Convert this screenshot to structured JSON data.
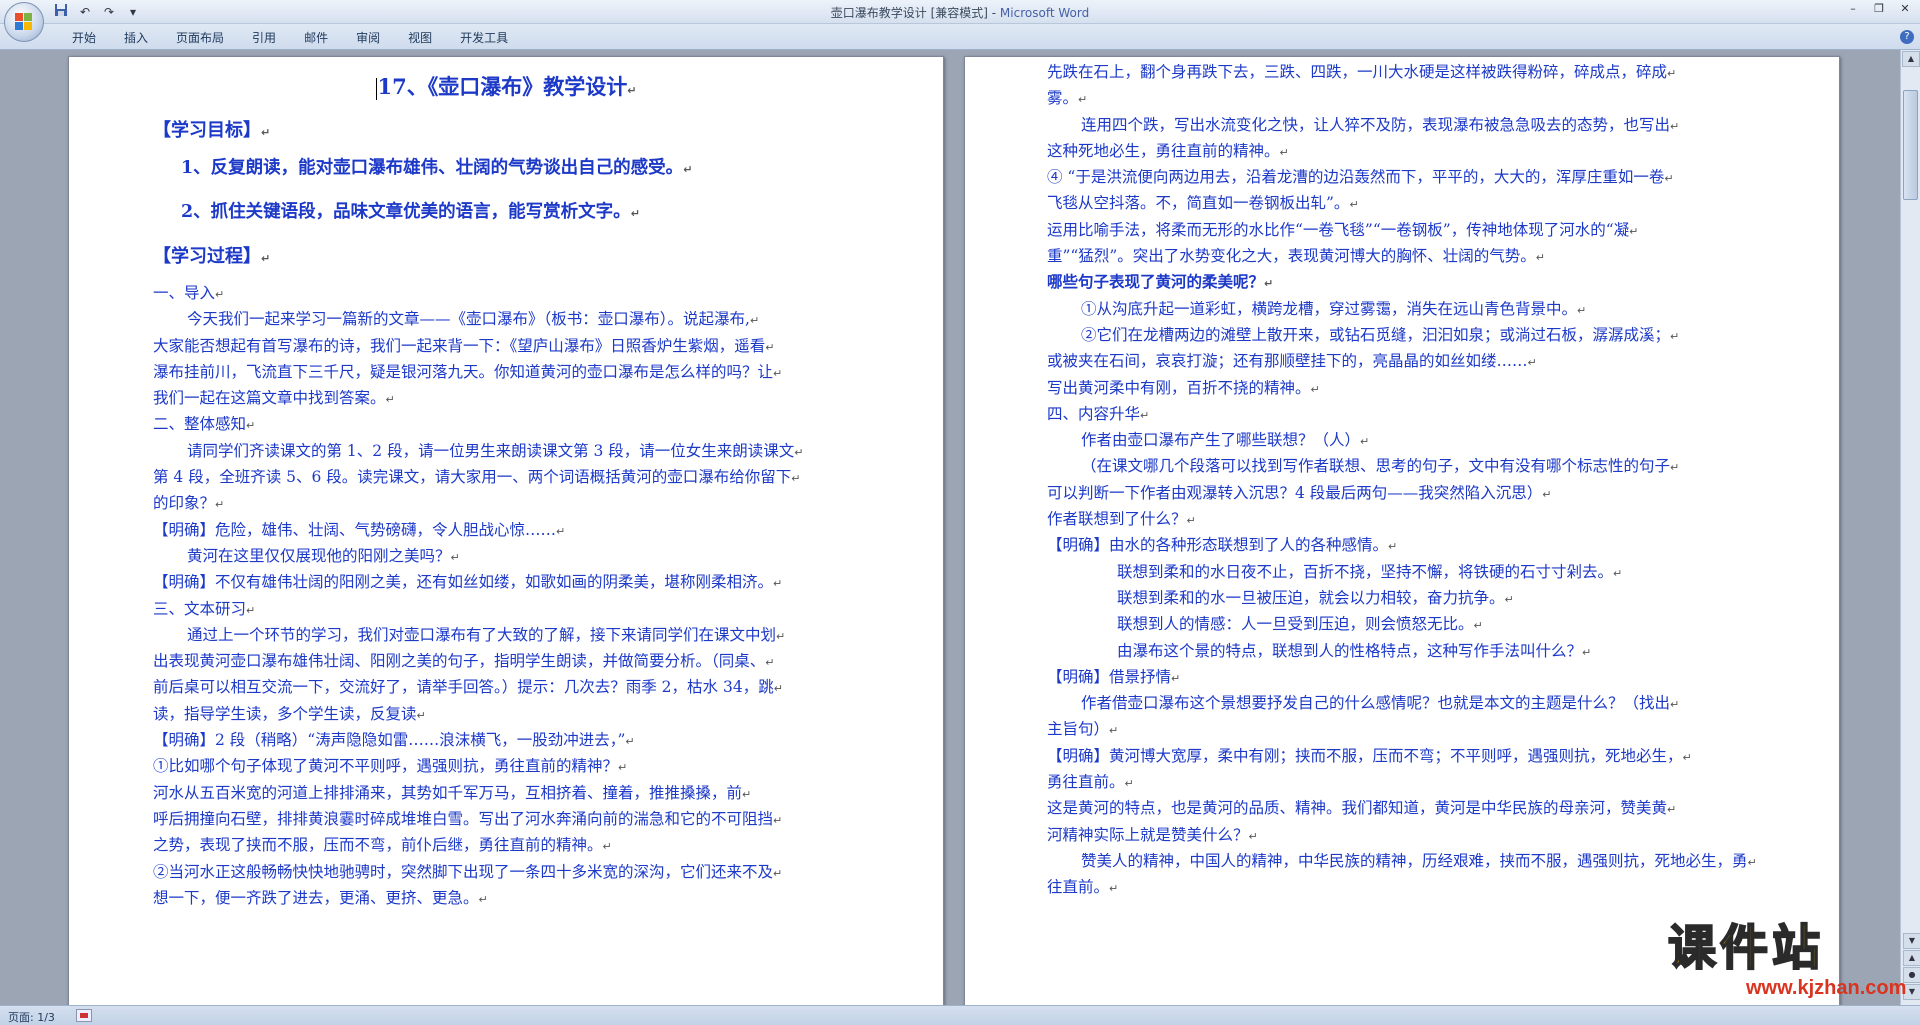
{
  "window": {
    "title": "壶口瀑布教学设计 [兼容模式] - ",
    "app_name": "Microsoft Word",
    "controls": [
      "–",
      "❐",
      "✕"
    ]
  },
  "qat": {
    "save_icon": "save-icon",
    "undo_icon": "undo-icon",
    "redo_icon": "redo-icon"
  },
  "ribbon": {
    "tabs": [
      "开始",
      "插入",
      "页面布局",
      "引用",
      "邮件",
      "审阅",
      "视图",
      "开发工具"
    ],
    "help": "?"
  },
  "status": {
    "page": "页面: 1/3"
  },
  "watermark": {
    "text": "课件站",
    "url": "www.kjzhan.com"
  },
  "page1": {
    "title": "17、《壶口瀑布》教学设计",
    "sec_goal": "【学习目标】",
    "goal1": "1、反复朗读，能对壶口瀑布雄伟、壮阔的气势谈出自己的感受。",
    "goal2": "2、抓住关键语段，品味文章优美的语言，能写赏析文字。",
    "sec_process": "【学习过程】",
    "lines": [
      "一、导入",
      "今天我们一起来学习一篇新的文章——《壶口瀑布》（板书：壶口瀑布）。说起瀑布,",
      "大家能否想起有首写瀑布的诗，我们一起来背一下：《望庐山瀑布》日照香炉生紫烟，遥看",
      "瀑布挂前川，飞流直下三千尺，疑是银河落九天。你知道黄河的壶口瀑布是怎么样的吗？让",
      "我们一起在这篇文章中找到答案。",
      "二、整体感知",
      "请同学们齐读课文的第 1、2 段，请一位男生来朗读课文第 3 段，请一位女生来朗读课文",
      "第 4 段，全班齐读 5、6 段。读完课文，请大家用一、两个词语概括黄河的壶口瀑布给你留下",
      "的印象？",
      "【明确】危险，雄伟、壮阔、气势磅礴，令人胆战心惊……",
      "黄河在这里仅仅展现他的阳刚之美吗？",
      "【明确】不仅有雄伟壮阔的阳刚之美，还有如丝如缕，如歌如画的阴柔美，堪称刚柔相济。",
      "三、文本研习",
      "通过上一个环节的学习，我们对壶口瀑布有了大致的了解，接下来请同学们在课文中划",
      "出表现黄河壶口瀑布雄伟壮阔、阳刚之美的句子，指明学生朗读，并做简要分析。（同桌、",
      "前后桌可以相互交流一下，交流好了，请举手回答。）提示：几次去？雨季 2，枯水 34，跳",
      "读，指导学生读，多个学生读，反复读",
      "【明确】2 段（稍略）“涛声隐隐如雷……浪沫横飞，一股劲冲进去，”",
      "①比如哪个句子体现了黄河不平则呼，遇强则抗，勇往直前的精神？",
      "河水从五百米宽的河道上排排涌来，其势如千军万马，互相挤着、撞着，推推搡搡，前",
      "呼后拥撞向石壁，排排黄浪霎时碎成堆堆白雪。写出了河水奔涌向前的湍急和它的不可阻挡",
      "之势，表现了挟而不服，压而不弯，前仆后继，勇往直前的精神。",
      "②当河水正这般畅畅快快地驰骋时，突然脚下出现了一条四十多米宽的深沟，它们还来不及",
      "想一下，便一齐跌了进去，更涌、更挤、更急。"
    ]
  },
  "page2": {
    "lines": [
      "先跌在石上，翻个身再跌下去，三跌、四跌，一川大水硬是这样被跌得粉碎，碎成点，碎成",
      "雾。",
      "连用四个跌，写出水流变化之快，让人猝不及防，表现瀑布被急急吸去的态势，也写出",
      "这种死地必生，勇往直前的精神。",
      "④ “于是洪流便向两边用去，沿着龙漕的边沿轰然而下，平平的，大大的，浑厚庄重如一卷",
      "飞毯从空抖落。不，简直如一卷钢板出轧”。",
      "运用比喻手法，将柔而无形的水比作“一卷飞毯”“一卷钢板”，传神地体现了河水的“凝",
      "重”“猛烈”。突出了水势变化之大，表现黄河博大的胸怀、壮阔的气势。",
      "哪些句子表现了黄河的柔美呢？",
      "①从沟底升起一道彩虹，横跨龙槽，穿过雾霭，消失在远山青色背景中。",
      "②它们在龙槽两边的滩壁上散开来，或钻石觅缝，汩汩如泉；或淌过石板，潺潺成溪；",
      "或被夹在石间，哀哀打漩；还有那顺壁挂下的，亮晶晶的如丝如缕……",
      "写出黄河柔中有刚，百折不挠的精神。",
      "四、内容升华",
      "作者由壶口瀑布产生了哪些联想？（人）",
      "（在课文哪几个段落可以找到写作者联想、思考的句子，文中有没有哪个标志性的句子",
      "可以判断一下作者由观瀑转入沉思？4 段最后两句——我突然陷入沉思）",
      "作者联想到了什么？",
      "【明确】由水的各种形态联想到了人的各种感情。",
      "联想到柔和的水日夜不止，百折不挠，坚持不懈，将铁硬的石寸寸剁去。",
      "联想到柔和的水一旦被压迫，就会以力相较，奋力抗争。",
      "联想到人的情感：人一旦受到压迫，则会愤怒无比。",
      "由瀑布这个景的特点，联想到人的性格特点，这种写作手法叫什么？",
      "【明确】借景抒情",
      "作者借壶口瀑布这个景想要抒发自己的什么感情呢？也就是本文的主题是什么？（找出",
      "主旨句）",
      "【明确】黄河博大宽厚，柔中有刚；挟而不服，压而不弯；不平则呼，遇强则抗，死地必生，",
      "勇往直前。",
      "这是黄河的特点，也是黄河的品质、精神。我们都知道，黄河是中华民族的母亲河，赞美黄",
      "河精神实际上就是赞美什么？",
      "赞美人的精神，中国人的精神，中华民族的精神，历经艰难，挟而不服，遇强则抗，死地必生，勇",
      "往直前。"
    ]
  }
}
